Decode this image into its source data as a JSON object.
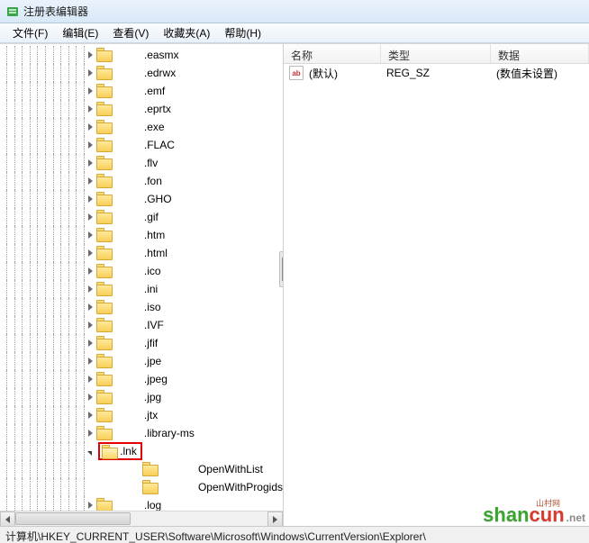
{
  "window": {
    "title": "注册表编辑器"
  },
  "menu": {
    "file": "文件(F)",
    "edit": "编辑(E)",
    "view": "查看(V)",
    "fav": "收藏夹(A)",
    "help": "帮助(H)"
  },
  "tree": {
    "items": [
      {
        "label": ".easmx"
      },
      {
        "label": ".edrwx"
      },
      {
        "label": ".emf"
      },
      {
        "label": ".eprtx"
      },
      {
        "label": ".exe"
      },
      {
        "label": ".FLAC"
      },
      {
        "label": ".flv"
      },
      {
        "label": ".fon"
      },
      {
        "label": ".GHO"
      },
      {
        "label": ".gif"
      },
      {
        "label": ".htm"
      },
      {
        "label": ".html"
      },
      {
        "label": ".ico"
      },
      {
        "label": ".ini"
      },
      {
        "label": ".iso"
      },
      {
        "label": ".IVF"
      },
      {
        "label": ".jfif"
      },
      {
        "label": ".jpe"
      },
      {
        "label": ".jpeg"
      },
      {
        "label": ".jpg"
      },
      {
        "label": ".jtx"
      },
      {
        "label": ".library-ms"
      }
    ],
    "selected": {
      "label": ".lnk"
    },
    "children": [
      {
        "label": "OpenWithList"
      },
      {
        "label": "OpenWithProgids"
      }
    ],
    "after": [
      {
        "label": ".log"
      }
    ]
  },
  "list": {
    "headers": {
      "name": "名称",
      "type": "类型",
      "data": "数据"
    },
    "rows": [
      {
        "icon": "ab",
        "name": "(默认)",
        "type": "REG_SZ",
        "data": "(数值未设置)"
      }
    ]
  },
  "statusbar": {
    "path": "计算机\\HKEY_CURRENT_USER\\Software\\Microsoft\\Windows\\CurrentVersion\\Explorer\\"
  },
  "watermark": {
    "a": "shan",
    "b": "cun",
    "c": ".net",
    "sub": "山村网"
  }
}
